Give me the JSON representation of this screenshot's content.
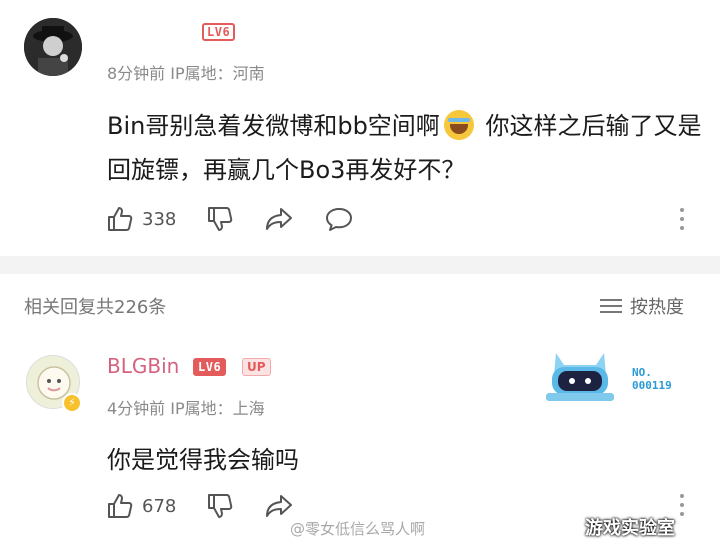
{
  "comment": {
    "level": "LV6",
    "meta": "8分钟前 IP属地：河南",
    "content_before": "Bin哥别急着发微博和bb空间啊",
    "content_after": " 你这样之后输了又是回旋镖，再赢几个Bo3再发好不？",
    "likes": "338"
  },
  "replies": {
    "header": "相关回复共226条",
    "sort_label": "按热度"
  },
  "reply": {
    "username": "BLGBin",
    "level": "LV6",
    "up_badge": "UP",
    "meta": "4分钟前 IP属地：上海",
    "content": "你是觉得我会输吗",
    "likes": "678",
    "badge_number_line1": "NO.",
    "badge_number_line2": "000119"
  },
  "watermark": "@零女低信么骂人啊",
  "brand": "游戏实验室",
  "icons": {
    "like": "thumbs-up-icon",
    "dislike": "thumbs-down-icon",
    "share": "share-icon",
    "comment": "comment-icon",
    "more": "more-icon",
    "sort": "sort-icon"
  },
  "colors": {
    "username": "#d6627f",
    "level_badge": "#e35b5b",
    "badge_number": "#2b9bd8"
  }
}
